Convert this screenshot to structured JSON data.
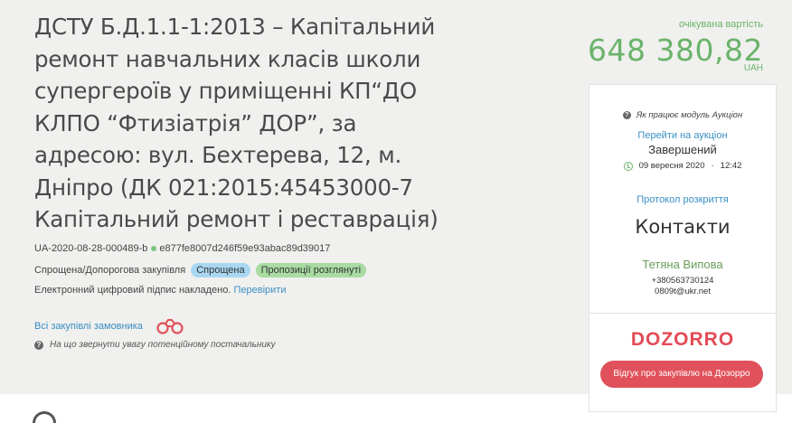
{
  "tender": {
    "title": "ДСТУ Б.Д.1.1-1:2013 – Капітальний ремонт навчальних класів школи супергероїв у приміщенні КП“ДО КЛПО “Фтизіатрія” ДОР”, за адресою: вул. Бехтерева, 12, м. Дніпро (ДК 021:2015:45453000-7 Капітальний ремонт і реставрація)",
    "tender_id": "UA-2020-08-28-000489-b",
    "hash": "e877fe8007d246f59e93abac89d39017",
    "procedure_type": "Спрощена/Допорогова закупівля",
    "badge_type": "Спрощена",
    "badge_status": "Пропозиції розглянуті",
    "signature_text": "Електронний цифровий підпис накладено.",
    "signature_link": "Перевірити",
    "all_tenders_link": "Всі закупівлі замовника",
    "attention_text": "На що звернути увагу потенційному постачальнику"
  },
  "price": {
    "label": "очікувана вартість",
    "value": "648 380,82",
    "currency": "UAH"
  },
  "panel": {
    "how_auction": "Як працює модуль Аукціон",
    "goto_auction": "Перейти на аукціон",
    "status": "Завершений",
    "date": "09 вересня 2020",
    "time": "12:42",
    "protocol": "Протокол розкриття",
    "contacts_title": "Контакти",
    "person": "Тетяна Випова",
    "phone": "+380563730124",
    "email": "0809t@ukr.net",
    "dozorro_logo": "DOZORRO",
    "feedback_button": "Відгук про закупівлю на Дозорро"
  },
  "colors": {
    "accent_green": "#6bb36b",
    "link_blue": "#3a8fc4",
    "dozorro_red": "#e0515b",
    "badge_blue": "#a9d7f2",
    "badge_green": "#a9dba2"
  },
  "icons": {
    "question": "question-circle-icon",
    "clock": "clock-icon",
    "binoculars": "binoculars-icon"
  }
}
